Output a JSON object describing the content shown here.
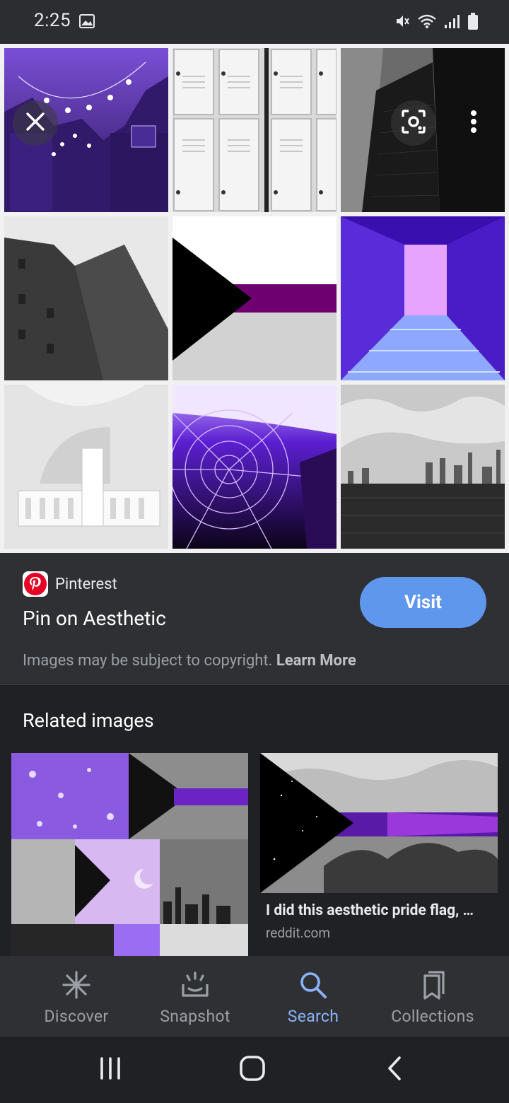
{
  "status_bar": {
    "time": "2:25",
    "icons": [
      "gallery-icon",
      "mute-icon",
      "wifi-icon",
      "signal-icon",
      "battery-icon"
    ]
  },
  "viewer": {
    "buttons": [
      "close-icon",
      "lens-icon",
      "more-options-icon"
    ]
  },
  "result": {
    "source": "Pinterest",
    "title": "Pin on Aesthetic",
    "visit_label": "Visit",
    "copyright_text": "Images may be subject to copyright. ",
    "learn_more": "Learn More"
  },
  "related": {
    "heading": "Related images",
    "items": [
      {
        "caption": "I did this aesthetic pride flag, …",
        "domain": "reddit.com"
      }
    ]
  },
  "bottom_nav": {
    "items": [
      {
        "label": "Discover",
        "icon": "asterisk-icon",
        "active": false
      },
      {
        "label": "Snapshot",
        "icon": "snapshot-icon",
        "active": false
      },
      {
        "label": "Search",
        "icon": "search-icon",
        "active": true
      },
      {
        "label": "Collections",
        "icon": "collections-icon",
        "active": false
      }
    ]
  },
  "colors": {
    "accent": "#8ab4f8",
    "visit_button": "#5f97ec",
    "panel_bg": "#2f3034",
    "page_bg": "#202124"
  }
}
